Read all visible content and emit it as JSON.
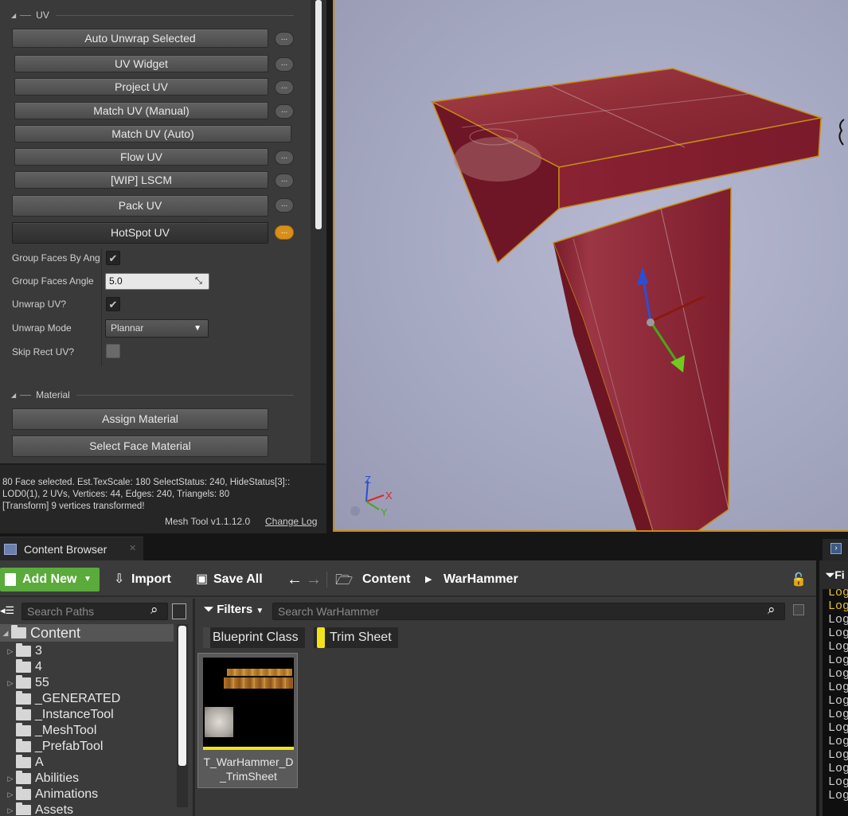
{
  "uv_section": {
    "title": "UV",
    "buttons": [
      {
        "label": "Auto Unwrap Selected",
        "has_more": true
      },
      {
        "label": "UV Widget",
        "has_more": true
      },
      {
        "label": "Project UV",
        "has_more": true
      },
      {
        "label": "Match UV (Manual)",
        "has_more": true
      },
      {
        "label": "Match UV (Auto)",
        "has_more": false
      },
      {
        "label": "Flow UV",
        "has_more": true
      },
      {
        "label": "[WIP] LSCM",
        "has_more": true
      },
      {
        "label": "Pack UV",
        "has_more": true
      },
      {
        "label": "HotSpot UV",
        "has_more": true
      }
    ],
    "more_label": "...",
    "props": {
      "group_faces_by_angle": {
        "label": "Group Faces By Angle",
        "checked": true
      },
      "group_faces_angle": {
        "label": "Group Faces Angle",
        "value": "5.0"
      },
      "unwrap_uv": {
        "label": "Unwrap UV?",
        "checked": true
      },
      "unwrap_mode": {
        "label": "Unwrap Mode",
        "value": "Plannar"
      },
      "skip_rect_uv": {
        "label": "Skip Rect UV?",
        "checked": false
      }
    }
  },
  "material_section": {
    "title": "Material",
    "buttons": [
      "Assign Material",
      "Select Face Material"
    ]
  },
  "status": {
    "lines": [
      "80 Face selected. Est.TexScale: 180 SelectStatus: 240, HideStatus[3]::",
      "LOD0(1), 2 UVs, Vertices: 44, Edges: 240, Triangels: 80",
      "[Transform] 9 vertices transformed!"
    ],
    "version": "Mesh Tool v1.1.12.0",
    "changelog": "Change Log"
  },
  "viewport": {
    "axis": {
      "x": "X",
      "y": "Y",
      "z": "Z"
    }
  },
  "content_browser": {
    "tab_title": "Content Browser",
    "toolbar": {
      "add_new": "Add New",
      "import": "Import",
      "save_all": "Save All"
    },
    "breadcrumb": [
      "Content",
      "WarHammer"
    ],
    "search_paths_placeholder": "Search Paths",
    "tree": {
      "root": "Content",
      "items": [
        {
          "label": "3",
          "expandable": true
        },
        {
          "label": "4",
          "expandable": false
        },
        {
          "label": "55",
          "expandable": true
        },
        {
          "label": "_GENERATED",
          "expandable": false
        },
        {
          "label": "_InstanceTool",
          "expandable": false
        },
        {
          "label": "_MeshTool",
          "expandable": false
        },
        {
          "label": "_PrefabTool",
          "expandable": false
        },
        {
          "label": "A",
          "expandable": false
        },
        {
          "label": "Abilities",
          "expandable": true
        },
        {
          "label": "Animations",
          "expandable": true
        },
        {
          "label": "Assets",
          "expandable": true
        }
      ]
    },
    "filters_label": "Filters",
    "search_assets_placeholder": "Search WarHammer",
    "filter_chips": [
      {
        "label": "Blueprint Class",
        "color": "#3a3a3a"
      },
      {
        "label": "Trim Sheet",
        "color": "#f2e21b"
      }
    ],
    "assets": [
      {
        "name_line1": "T_WarHammer_D",
        "name_line2": "_TrimSheet",
        "type_color": "#f2e21b"
      }
    ]
  },
  "output_log": {
    "header": "Fi",
    "line_text": "Log",
    "lines": [
      "warn",
      "warn",
      "normal",
      "normal",
      "normal",
      "normal",
      "normal",
      "normal",
      "normal",
      "normal",
      "normal",
      "normal",
      "normal",
      "normal",
      "normal",
      "normal"
    ]
  }
}
